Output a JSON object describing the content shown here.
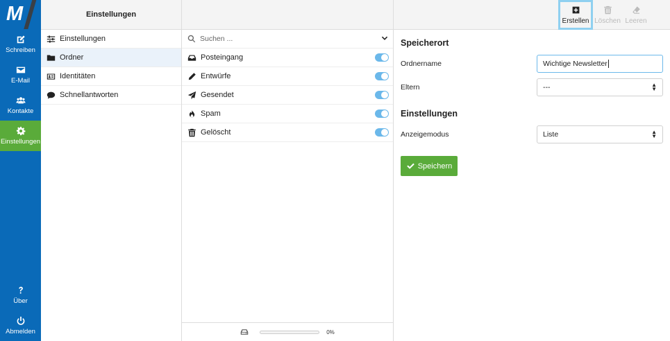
{
  "nav": {
    "logo": "M",
    "items": [
      {
        "label": "Schreiben",
        "icon": "edit-icon"
      },
      {
        "label": "E-Mail",
        "icon": "envelope-icon"
      },
      {
        "label": "Kontakte",
        "icon": "users-icon"
      },
      {
        "label": "Einstellungen",
        "icon": "gear-icon",
        "active": true
      }
    ],
    "bottom": [
      {
        "label": "Über",
        "icon": "question-icon"
      },
      {
        "label": "Abmelden",
        "icon": "power-icon"
      }
    ]
  },
  "settings": {
    "title": "Einstellungen",
    "items": [
      {
        "label": "Einstellungen",
        "icon": "sliders-icon"
      },
      {
        "label": "Ordner",
        "icon": "folder-icon",
        "active": true
      },
      {
        "label": "Identitäten",
        "icon": "id-card-icon"
      },
      {
        "label": "Schnellantworten",
        "icon": "comment-icon"
      }
    ]
  },
  "folders": {
    "search_placeholder": "Suchen ...",
    "items": [
      {
        "label": "Posteingang",
        "icon": "inbox-icon",
        "subscribed": true
      },
      {
        "label": "Entwürfe",
        "icon": "pencil-icon",
        "subscribed": true
      },
      {
        "label": "Gesendet",
        "icon": "paper-plane-icon",
        "subscribed": true
      },
      {
        "label": "Spam",
        "icon": "fire-icon",
        "subscribed": true
      },
      {
        "label": "Gelöscht",
        "icon": "trash-icon",
        "subscribed": true
      }
    ],
    "quota_text": "0%",
    "quota_fraction": 0.0
  },
  "toolbar": {
    "create": "Erstellen",
    "delete": "Löschen",
    "empty": "Leeren"
  },
  "form": {
    "section_location": "Speicherort",
    "foldername_label": "Ordnername",
    "foldername_value": "Wichtige Newsletter",
    "parent_label": "Eltern",
    "parent_value": "---",
    "section_settings": "Einstellungen",
    "viewmode_label": "Anzeigemodus",
    "viewmode_value": "Liste",
    "save_label": "Speichern"
  },
  "colors": {
    "nav_bg": "#0a6ab8",
    "active_green": "#5aab3a",
    "toggle_blue": "#6bb8ea",
    "highlight_border": "#8fd0f0"
  }
}
